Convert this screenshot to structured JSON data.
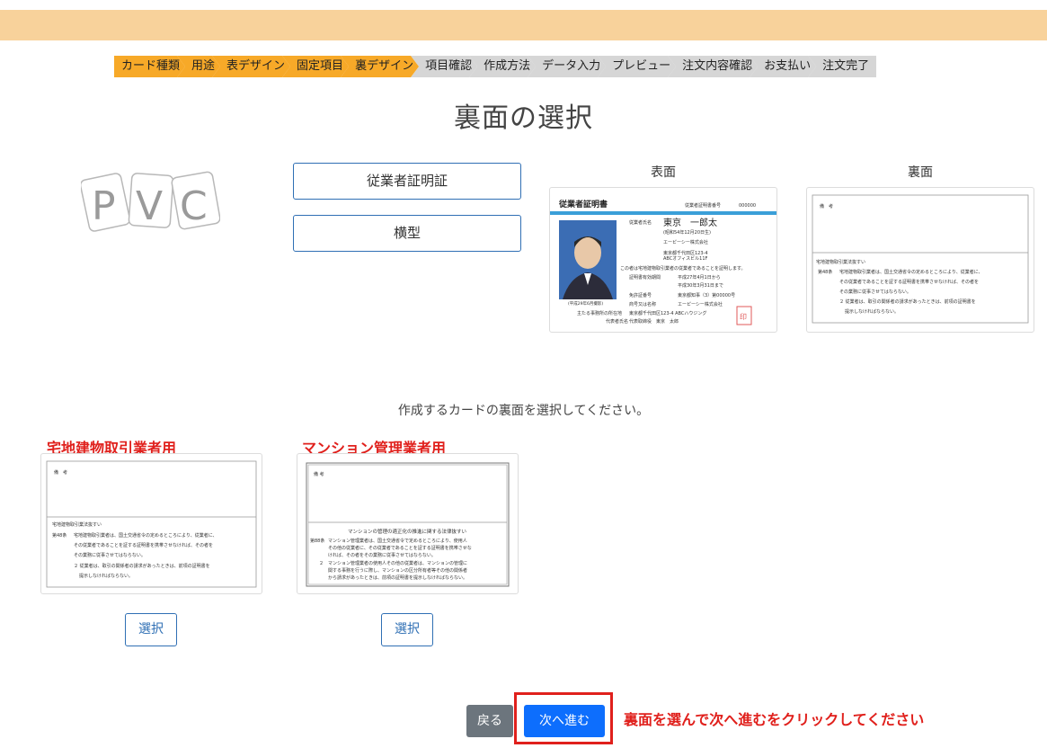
{
  "steps": [
    {
      "label": "カード種類",
      "state": "active"
    },
    {
      "label": "用途",
      "state": "active"
    },
    {
      "label": "表デザイン",
      "state": "active"
    },
    {
      "label": "固定項目",
      "state": "active"
    },
    {
      "label": "裏デザイン",
      "state": "active"
    },
    {
      "label": "項目確認",
      "state": "inactive"
    },
    {
      "label": "作成方法",
      "state": "inactive"
    },
    {
      "label": "データ入力",
      "state": "inactive"
    },
    {
      "label": "プレビュー",
      "state": "inactive"
    },
    {
      "label": "注文内容確認",
      "state": "inactive"
    },
    {
      "label": "お支払い",
      "state": "inactive"
    },
    {
      "label": "注文完了",
      "state": "inactive"
    }
  ],
  "page_title": "裏面の選択",
  "logo_text": "PVC",
  "options": {
    "usage": "従業者証明証",
    "orientation": "横型"
  },
  "preview": {
    "front_label": "表面",
    "back_label": "裏面",
    "front_card": {
      "title": "従業者証明書",
      "number_label": "従業者証明書番号",
      "number": "000000",
      "name_label": "従業者氏名",
      "name": "東京　一郎太",
      "birth": "(昭和54年12月20日生)",
      "company": "エーピーシー株式会社",
      "address": "東京都千代田区123-4",
      "building": "ABCオフィスビル11F",
      "statement": "この者は宅地建物取引業者の従業者であることを証明します。",
      "valid_label": "証明書有効期間",
      "valid_from": "平成27年4月1日から",
      "valid_to": "平成30年3月31日まで",
      "license_label": "免許証番号",
      "license": "東京都知事（3）第00000号",
      "trade_label": "商号又は名称",
      "trade": "エーピーシー株式会社",
      "office_label": "主たる事務所の所在地",
      "office": "東京都千代田区123-4 ABCハウジング",
      "rep_label": "代表者氏名",
      "rep": "代表取締役　東京　太郎",
      "photo_date": "(平成29年6月撮影)",
      "seal": "印"
    },
    "back_card": {
      "remarks": "備　考",
      "law": "宅地建物取引業法抜すい",
      "article": "第48条",
      "line1": "宅地建物取引業者は、国土交通省令の定めるところにより、従業者に、",
      "line2": "その従業者であることを証する証明書を携帯させなければ、その者を",
      "line3": "その業務に従事させてはならない。",
      "line4": "２ 従業者は、取引の関係者の請求があったときは、前項の証明書を",
      "line5": "提示しなければならない。"
    }
  },
  "instruction": "作成するカードの裏面を選択してください。",
  "choices": [
    {
      "label": "宅地建物取引業者用",
      "button": "選択"
    },
    {
      "label": "マンション管理業者用",
      "button": "選択"
    }
  ],
  "mansion_card": {
    "remarks": "備 考",
    "law": "マンションの管理の適正化の推進に関する法律抜すい",
    "article": "第88条",
    "line1": "マンション管理業者は、国土交通省令で定めるところにより、使用人",
    "line2": "その他の従業者に、その従業者であることを証する証明書を携帯させな",
    "line3": "ければ、その者をその業務に従事させてはならない。",
    "line4": "２　マンション管理業者の使用人その他の従業者は、マンションの管理に",
    "line5": "関する事務を行うに際し、マンションの区分所有者等その他の関係者",
    "line6": "から請求があったときは、前項の証明書を提示しなければならない。"
  },
  "footer": {
    "back_button": "戻る",
    "next_button": "次へ進む",
    "hint": "裏面を選んで次へ進むをクリックしてください"
  },
  "colors": {
    "topbar": "#f8d29b",
    "step_active": "#f7a928",
    "step_inactive": "#d6d6d6",
    "primary": "#0d6efd",
    "secondary": "#6c757d",
    "alert": "#e0201c"
  }
}
